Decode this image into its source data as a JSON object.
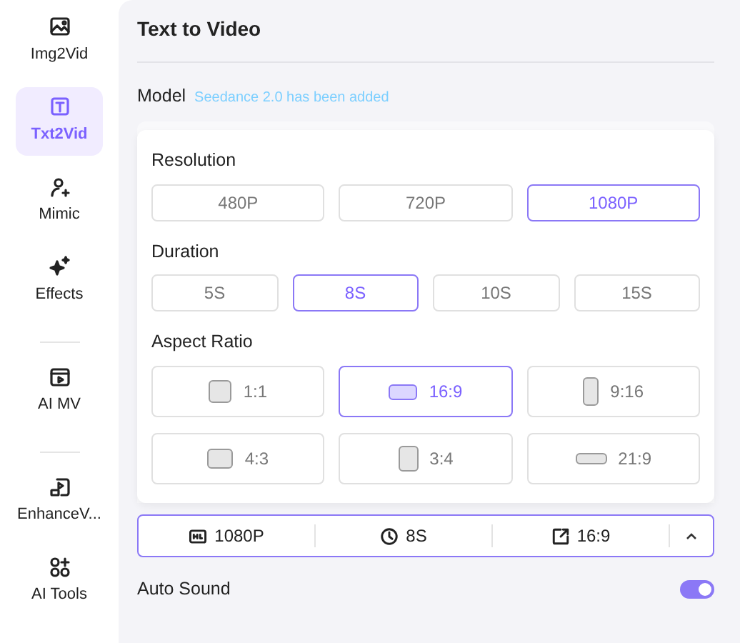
{
  "sidebar": {
    "groups": [
      [
        {
          "label": "Img2Vid",
          "kind": "image",
          "selected": false
        },
        {
          "label": "Txt2Vid",
          "kind": "text",
          "selected": true
        },
        {
          "label": "Mimic",
          "kind": "person",
          "selected": false
        },
        {
          "label": "Effects",
          "kind": "sparkle",
          "selected": false
        }
      ],
      [
        {
          "label": "AI MV",
          "kind": "clapper",
          "selected": false
        }
      ],
      [
        {
          "label": "EnhanceV...",
          "kind": "hd",
          "selected": false
        },
        {
          "label": "AI Tools",
          "kind": "tools",
          "selected": false
        }
      ]
    ]
  },
  "title": "Text to Video",
  "model": {
    "label": "Model",
    "notice": "Seedance 2.0 has been added"
  },
  "resolution": {
    "label": "Resolution",
    "options": [
      {
        "label": "480P",
        "selected": false
      },
      {
        "label": "720P",
        "selected": false
      },
      {
        "label": "1080P",
        "selected": true
      }
    ]
  },
  "duration": {
    "label": "Duration",
    "options": [
      {
        "label": "5S",
        "selected": false
      },
      {
        "label": "8S",
        "selected": true
      },
      {
        "label": "10S",
        "selected": false
      },
      {
        "label": "15S",
        "selected": false
      }
    ]
  },
  "aspect_ratio": {
    "label": "Aspect Ratio",
    "options": [
      {
        "label": "1:1",
        "kind": "square",
        "selected": false
      },
      {
        "label": "16:9",
        "kind": "landscape",
        "selected": true
      },
      {
        "label": "9:16",
        "kind": "portrait",
        "selected": false
      },
      {
        "label": "4:3",
        "kind": "standard",
        "selected": false
      },
      {
        "label": "3:4",
        "kind": "upright",
        "selected": false
      },
      {
        "label": "21:9",
        "kind": "panorama",
        "selected": false
      }
    ]
  },
  "summary": [
    {
      "kind": "hd",
      "label": "1080P"
    },
    {
      "kind": "clock",
      "label": "8S"
    },
    {
      "kind": "ratio",
      "label": "16:9"
    }
  ],
  "summary_expanded": true,
  "auto_sound": {
    "label": "Auto Sound",
    "on": true
  }
}
